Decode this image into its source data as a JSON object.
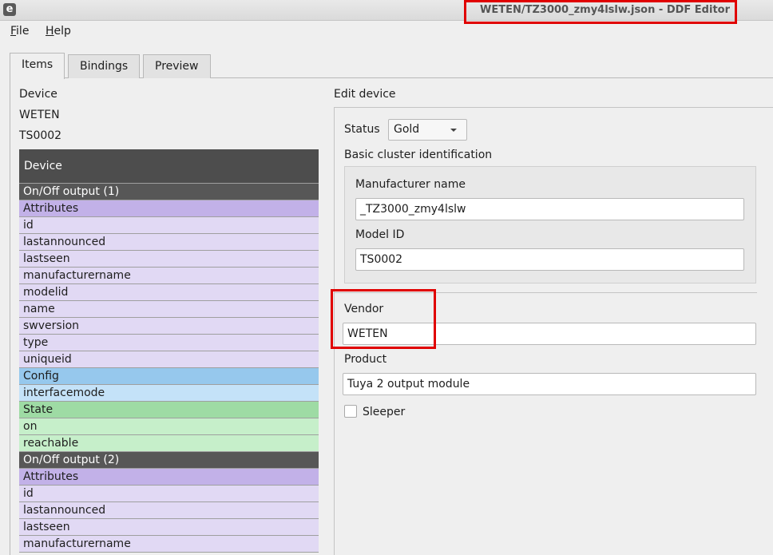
{
  "window": {
    "icon_letter": "e",
    "title": "WETEN/TZ3000_zmy4lslw.json - DDF Editor"
  },
  "menu": {
    "file": {
      "accel": "F",
      "rest": "ile"
    },
    "help": {
      "accel": "H",
      "rest": "elp"
    }
  },
  "tabs": [
    "Items",
    "Bindings",
    "Preview"
  ],
  "left": {
    "device_label": "Device",
    "vendor": "WETEN",
    "model": "TS0002"
  },
  "tree": [
    {
      "label": "Device",
      "kind": "device"
    },
    {
      "label": "On/Off output (1)",
      "kind": "subdevice"
    },
    {
      "label": "Attributes",
      "kind": "section-attr"
    },
    {
      "label": "id",
      "kind": "item-attr"
    },
    {
      "label": "lastannounced",
      "kind": "item-attr"
    },
    {
      "label": "lastseen",
      "kind": "item-attr"
    },
    {
      "label": "manufacturername",
      "kind": "item-attr"
    },
    {
      "label": "modelid",
      "kind": "item-attr"
    },
    {
      "label": "name",
      "kind": "item-attr"
    },
    {
      "label": "swversion",
      "kind": "item-attr"
    },
    {
      "label": "type",
      "kind": "item-attr"
    },
    {
      "label": "uniqueid",
      "kind": "item-attr"
    },
    {
      "label": "Config",
      "kind": "section-config"
    },
    {
      "label": "interfacemode",
      "kind": "item-config"
    },
    {
      "label": "State",
      "kind": "section-state"
    },
    {
      "label": "on",
      "kind": "item-state"
    },
    {
      "label": "reachable",
      "kind": "item-state"
    },
    {
      "label": "On/Off output (2)",
      "kind": "subdevice"
    },
    {
      "label": "Attributes",
      "kind": "section-attr"
    },
    {
      "label": "id",
      "kind": "item-attr"
    },
    {
      "label": "lastannounced",
      "kind": "item-attr"
    },
    {
      "label": "lastseen",
      "kind": "item-attr"
    },
    {
      "label": "manufacturername",
      "kind": "item-attr"
    }
  ],
  "edit": {
    "title": "Edit device",
    "status_label": "Status",
    "status_value": "Gold",
    "basic_cluster_label": "Basic cluster identification",
    "manufacturer_label": "Manufacturer name",
    "manufacturer_value": "_TZ3000_zmy4lslw",
    "model_label": "Model ID",
    "model_value": "TS0002",
    "vendor_label": "Vendor",
    "vendor_value": "WETEN",
    "product_label": "Product",
    "product_value": "Tuya 2 output module",
    "sleeper_label": "Sleeper",
    "sleeper_checked": false
  }
}
